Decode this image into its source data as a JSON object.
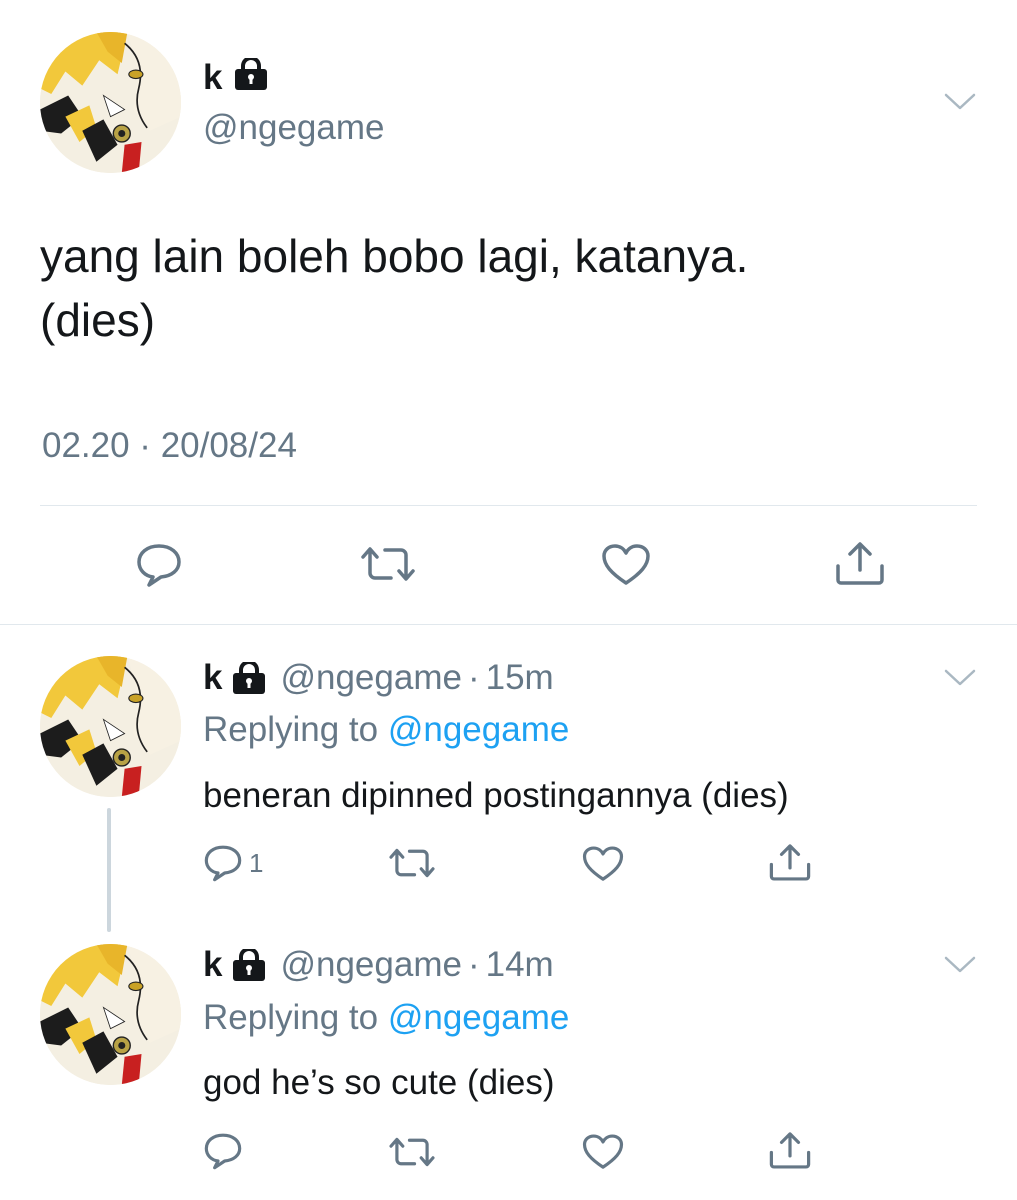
{
  "main_tweet": {
    "display_name": "k",
    "handle": "@ngegame",
    "text_line1": "yang lain boleh bobo lagi, katanya.",
    "text_line2": "(dies)",
    "timestamp": "02.20 · 20/08/24"
  },
  "replies": [
    {
      "display_name": "k",
      "handle": "@ngegame",
      "separator": "·",
      "time": "15m",
      "replying_to_label": "Replying to",
      "replying_to_handle": "@ngegame",
      "text": "beneran dipinned postingannya (dies)",
      "reply_count": "1"
    },
    {
      "display_name": "k",
      "handle": "@ngegame",
      "separator": "·",
      "time": "14m",
      "replying_to_label": "Replying to",
      "replying_to_handle": "@ngegame",
      "text": "god he’s so cute (dies)",
      "reply_count": ""
    }
  ],
  "icons": {
    "lock": "lock-icon",
    "chevron": "chevron-down-icon",
    "reply": "comment-icon",
    "retweet": "retweet-icon",
    "like": "heart-icon",
    "share": "share-icon"
  },
  "colors": {
    "text": "#14171a",
    "muted": "#657786",
    "link": "#1da1f2",
    "divider": "#e1e8ed"
  }
}
